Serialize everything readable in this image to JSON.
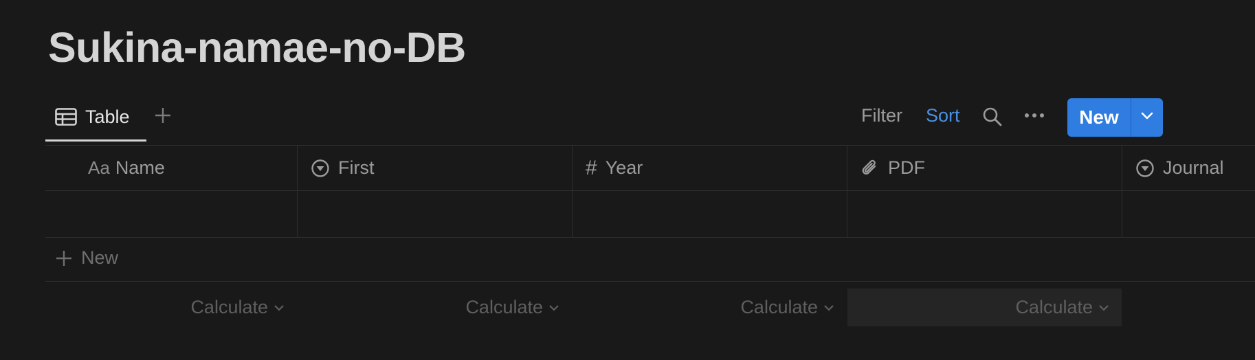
{
  "page": {
    "title": "Sukina-namae-no-DB"
  },
  "views": {
    "active_tab": {
      "label": "Table",
      "icon": "table-icon"
    },
    "add_view_icon": "plus-icon"
  },
  "toolbar": {
    "filter_label": "Filter",
    "sort_label": "Sort",
    "sort_color": "#4a90e2",
    "search_icon": "search-icon",
    "more_icon": "more-horizontal-icon",
    "new_button": {
      "label": "New",
      "color": "#2f7de1",
      "dropdown_icon": "chevron-down-icon"
    }
  },
  "table": {
    "columns": [
      {
        "label": "Name",
        "type_icon": "text-type-icon",
        "type_glyph": "Aa"
      },
      {
        "label": "First",
        "type_icon": "select-type-icon"
      },
      {
        "label": "Year",
        "type_icon": "number-type-icon",
        "type_glyph": "#"
      },
      {
        "label": "PDF",
        "type_icon": "paperclip-icon"
      },
      {
        "label": "Journal",
        "type_icon": "select-type-icon"
      }
    ],
    "new_row_label": "New",
    "calculate_label": "Calculate"
  }
}
